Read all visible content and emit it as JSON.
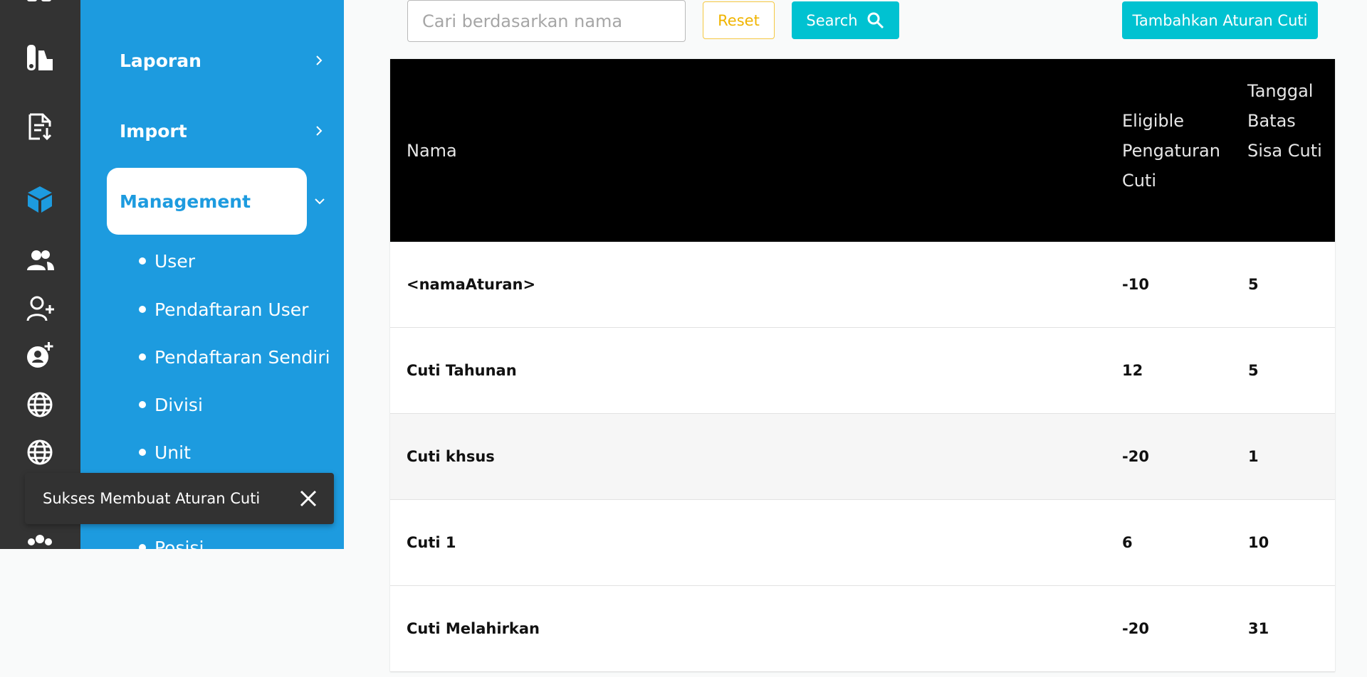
{
  "rail": {
    "icons": [
      "top-partial-icon",
      "chart-icon",
      "document-download-icon",
      "cube-icon",
      "users-icon",
      "add-user-icon",
      "account-plus-icon",
      "globe-icon",
      "globe-alt-icon",
      "group-icon"
    ],
    "active_color": "#1d9bdf"
  },
  "sidebar": {
    "items": [
      {
        "label": "Laporan"
      },
      {
        "label": "Import"
      },
      {
        "label": "Management"
      }
    ],
    "subitems": [
      {
        "label": "User"
      },
      {
        "label": "Pendaftaran User"
      },
      {
        "label": "Pendaftaran Sendiri"
      },
      {
        "label": "Divisi"
      },
      {
        "label": "Unit"
      },
      {
        "label": "Posisi"
      }
    ],
    "background": "#1d9bdf"
  },
  "toast": {
    "message": "Sukses Membuat Aturan Cuti"
  },
  "toolbar": {
    "search_placeholder": "Cari berdasarkan nama",
    "reset_label": "Reset",
    "search_label": "Search",
    "add_label": "Tambahkan Aturan Cuti",
    "accent": "#00c2d1",
    "reset_color": "#f0b400"
  },
  "table": {
    "headers": {
      "nama": "Nama",
      "eligible": "Eligible Pengaturan Cuti",
      "tanggal": "Tanggal Batas Sisa Cuti"
    },
    "rows": [
      {
        "nama": "<namaAturan>",
        "eligible": "-10",
        "tanggal": "5"
      },
      {
        "nama": "Cuti Tahunan",
        "eligible": "12",
        "tanggal": "5"
      },
      {
        "nama": "Cuti khsus",
        "eligible": "-20",
        "tanggal": "1"
      },
      {
        "nama": "Cuti 1",
        "eligible": "6",
        "tanggal": "10"
      },
      {
        "nama": "Cuti Melahirkan",
        "eligible": "-20",
        "tanggal": "31"
      }
    ]
  }
}
